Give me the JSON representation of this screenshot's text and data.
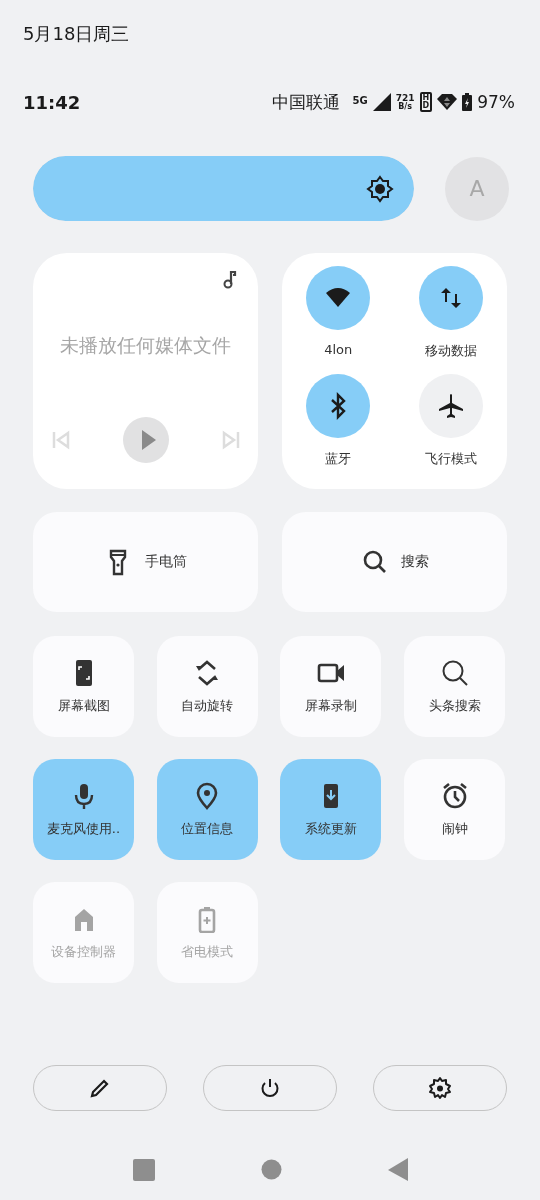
{
  "header": {
    "date": "5月18日周三"
  },
  "status_bar": {
    "time": "11:42",
    "carrier": "中国联通",
    "network": "5G",
    "speed": "721",
    "speed_unit": "B/s",
    "hd_top": "H",
    "hd_bottom": "D",
    "battery": "97%"
  },
  "brightness": {
    "level": 1
  },
  "auto_button": {
    "label": "A"
  },
  "media": {
    "message": "未播放任何媒体文件"
  },
  "connectivity": [
    {
      "label": "4lon",
      "on": true
    },
    {
      "label": "移动数据",
      "on": true
    },
    {
      "label": "蓝牙",
      "on": true
    },
    {
      "label": "飞行模式",
      "on": false
    }
  ],
  "wide_tiles": [
    {
      "label": "手电筒"
    },
    {
      "label": "搜索"
    }
  ],
  "tiles": [
    {
      "label": "屏幕截图",
      "on": false,
      "disabled": false
    },
    {
      "label": "自动旋转",
      "on": false,
      "disabled": false
    },
    {
      "label": "屏幕录制",
      "on": false,
      "disabled": false
    },
    {
      "label": "头条搜索",
      "on": false,
      "disabled": false
    },
    {
      "label": "麦克风使用..",
      "on": true,
      "disabled": false
    },
    {
      "label": "位置信息",
      "on": true,
      "disabled": false
    },
    {
      "label": "系统更新",
      "on": true,
      "disabled": false
    },
    {
      "label": "闹钟",
      "on": false,
      "disabled": false
    },
    {
      "label": "设备控制器",
      "on": false,
      "disabled": true
    },
    {
      "label": "省电模式",
      "on": false,
      "disabled": true
    }
  ]
}
